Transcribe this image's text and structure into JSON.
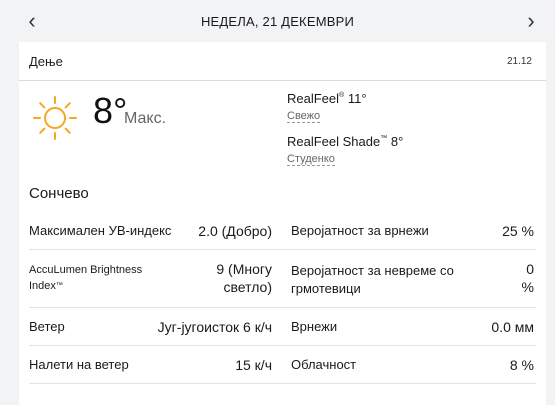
{
  "nav": {
    "prev_icon": "chevron-left-icon",
    "next_icon": "chevron-right-icon",
    "date": "НЕДЕЛА, 21 ДЕКЕМВРИ",
    "prev_glyph": "‹",
    "next_glyph": "›"
  },
  "card": {
    "title": "Дење",
    "date": "21.12",
    "weather_icon": "sun-icon",
    "temperature": "8°",
    "temp_label": "Макс.",
    "realfeel": {
      "label": "RealFeel",
      "tm": "®",
      "value": "11°",
      "desc": "Свежо"
    },
    "realfeel_shade": {
      "label": "RealFeel Shade",
      "tm": "™",
      "value": "8°",
      "desc": "Студенко"
    },
    "section_title": "Сончево",
    "left_rows": [
      {
        "label": "Максимален УВ-индекс",
        "value": "2.0 (Добро)"
      },
      {
        "label": "AccuLumen Brightness Index",
        "tm": "™",
        "value_line1": "9 (Многу",
        "value_line2": "светло)"
      },
      {
        "label": "Ветер",
        "value": "Југ-југоисток 6 к/ч"
      },
      {
        "label": "Налети на ветер",
        "value": "15 к/ч"
      }
    ],
    "right_rows": [
      {
        "label": "Веројатност за врнежи",
        "value": "25 %"
      },
      {
        "label_line1": "Веројатност за невреме со",
        "label_line2": "грмотевици",
        "value_line1": "0",
        "value_line2": "%"
      },
      {
        "label": "Врнежи",
        "value": "0.0 мм"
      },
      {
        "label": "Облачност",
        "value": "8 %"
      }
    ]
  },
  "colors": {
    "sun": "#f5a623",
    "background": "#f2f3f5",
    "card": "#ffffff"
  }
}
